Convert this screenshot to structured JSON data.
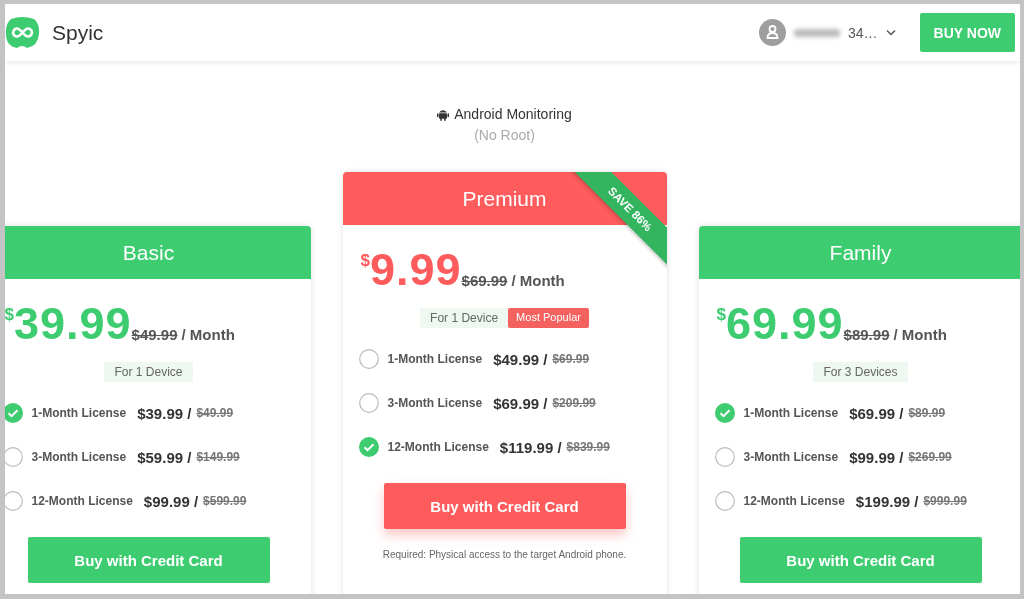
{
  "header": {
    "brand": "Spyic",
    "account": "34…",
    "buy_button": "BUY NOW"
  },
  "platform": {
    "label": "Android Monitoring",
    "note": "(No Root)"
  },
  "plans": [
    {
      "name": "Basic",
      "color": "#3ecc71",
      "currency": "$",
      "price": "39.99",
      "old_price": "$49.99",
      "period": "/ Month",
      "devices": "For 1 Device",
      "licenses": [
        {
          "label": "1-Month License",
          "price": "$39.99 /",
          "old_price": "$49.99",
          "selected": true
        },
        {
          "label": "3-Month License",
          "price": "$59.99 /",
          "old_price": "$149.99",
          "selected": false
        },
        {
          "label": "12-Month License",
          "price": "$99.99 /",
          "old_price": "$599.99",
          "selected": false
        }
      ],
      "button": "Buy with Credit Card"
    },
    {
      "name": "Premium",
      "color": "#fe5b5c",
      "ribbon": "SAVE 86%",
      "currency": "$",
      "price": "9.99",
      "old_price": "$69.99",
      "period": "/ Month",
      "devices": "For 1 Device",
      "badge": "Most Popular",
      "licenses": [
        {
          "label": "1-Month License",
          "price": "$49.99 /",
          "old_price": "$69.99",
          "selected": false
        },
        {
          "label": "3-Month License",
          "price": "$69.99 /",
          "old_price": "$209.99",
          "selected": false
        },
        {
          "label": "12-Month License",
          "price": "$119.99 /",
          "old_price": "$839.99",
          "selected": true
        }
      ],
      "button": "Buy with Credit Card",
      "requirement": "Required: Physical access to the target Android phone."
    },
    {
      "name": "Family",
      "color": "#3ecc71",
      "currency": "$",
      "price": "69.99",
      "old_price": "$89.99",
      "period": "/ Month",
      "devices": "For 3 Devices",
      "licenses": [
        {
          "label": "1-Month License",
          "price": "$69.99 /",
          "old_price": "$89.99",
          "selected": true
        },
        {
          "label": "3-Month License",
          "price": "$99.99 /",
          "old_price": "$269.99",
          "selected": false
        },
        {
          "label": "12-Month License",
          "price": "$199.99 /",
          "old_price": "$999.99",
          "selected": false
        }
      ],
      "button": "Buy with Credit Card"
    }
  ]
}
